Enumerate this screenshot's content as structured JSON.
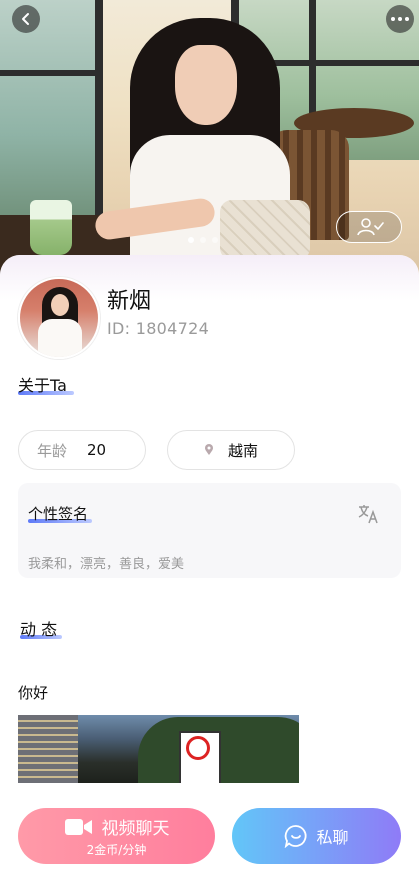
{
  "profile": {
    "name": "新烟",
    "id_text": "ID: 1804724"
  },
  "about": {
    "title": "关于Ta",
    "age_label": "年龄",
    "age_value": "20",
    "location": "越南"
  },
  "signature": {
    "title": "个性签名",
    "text": "我柔和，漂亮，善良，爱美"
  },
  "moments": {
    "title": "动 态",
    "post_text": "你好"
  },
  "actions": {
    "video_label": "视频聊天",
    "video_price": "2金币/分钟",
    "chat_label": "私聊"
  },
  "carousel": {
    "pages": 3,
    "current": 1
  },
  "icons": [
    "back-icon",
    "more-icon",
    "verify-person-icon",
    "location-pin-icon",
    "translate-icon",
    "video-camera-icon",
    "chat-bubble-icon"
  ],
  "colors": {
    "video_gradient": [
      "#ff9aa8",
      "#ff7e9d"
    ],
    "chat_gradient": [
      "#62c6f8",
      "#8f7bf7"
    ],
    "title_underline": "#4d6cf7"
  }
}
